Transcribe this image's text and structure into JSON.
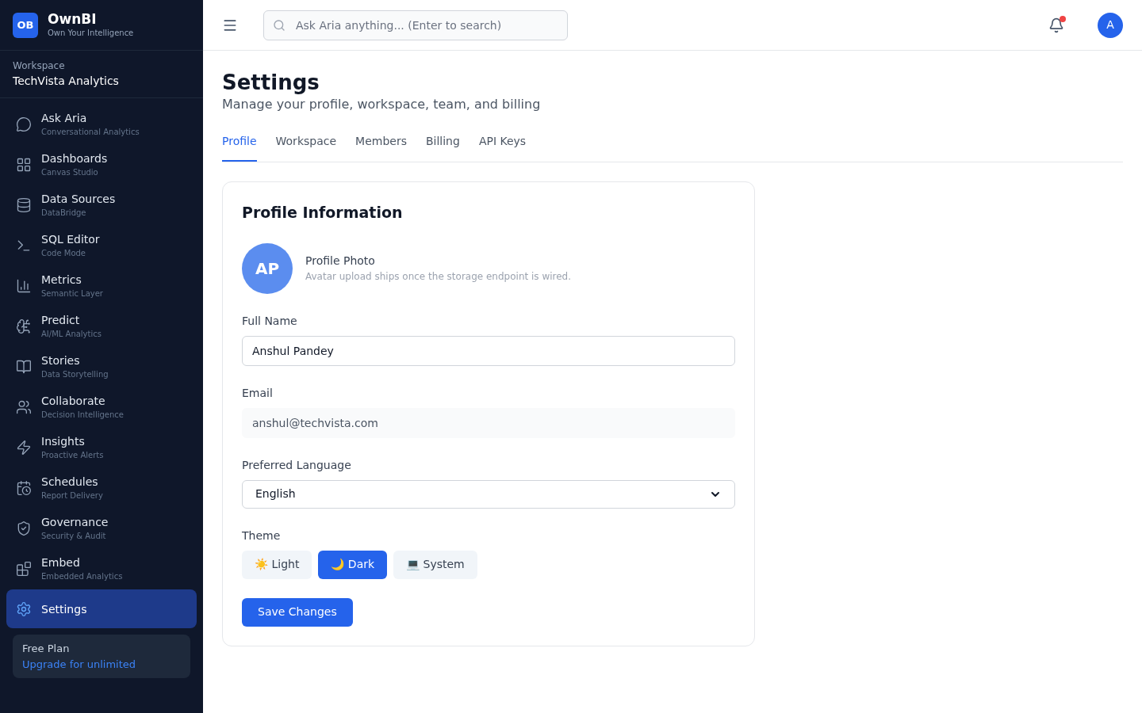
{
  "brand": {
    "logo": "OB",
    "name": "OwnBI",
    "tagline": "Own Your Intelligence"
  },
  "workspace": {
    "label": "Workspace",
    "name": "TechVista Analytics"
  },
  "nav": [
    {
      "label": "Ask Aria",
      "sub": "Conversational Analytics",
      "selected": false
    },
    {
      "label": "Dashboards",
      "sub": "Canvas Studio",
      "selected": false
    },
    {
      "label": "Data Sources",
      "sub": "DataBridge",
      "selected": false
    },
    {
      "label": "SQL Editor",
      "sub": "Code Mode",
      "selected": false
    },
    {
      "label": "Metrics",
      "sub": "Semantic Layer",
      "selected": false
    },
    {
      "label": "Predict",
      "sub": "AI/ML Analytics",
      "selected": false
    },
    {
      "label": "Stories",
      "sub": "Data Storytelling",
      "selected": false
    },
    {
      "label": "Collaborate",
      "sub": "Decision Intelligence",
      "selected": false
    },
    {
      "label": "Insights",
      "sub": "Proactive Alerts",
      "selected": false
    },
    {
      "label": "Schedules",
      "sub": "Report Delivery",
      "selected": false
    },
    {
      "label": "Governance",
      "sub": "Security & Audit",
      "selected": false
    },
    {
      "label": "Embed",
      "sub": "Embedded Analytics",
      "selected": false
    },
    {
      "label": "Settings",
      "selected": true
    }
  ],
  "plan": {
    "name": "Free Plan",
    "link": "Upgrade for unlimited"
  },
  "topbar": {
    "search_placeholder": "Ask Aria anything... (Enter to search)",
    "notification": true,
    "avatar": "A"
  },
  "page": {
    "title": "Settings",
    "subtitle": "Manage your profile, workspace, team, and billing"
  },
  "tabs": [
    {
      "label": "Profile",
      "selected": true
    },
    {
      "label": "Workspace",
      "selected": false
    },
    {
      "label": "Members",
      "selected": false
    },
    {
      "label": "Billing",
      "selected": false
    },
    {
      "label": "API Keys",
      "selected": false
    }
  ],
  "profile": {
    "title": "Profile Information",
    "avatar": "AP",
    "photo_label": "Profile Photo",
    "photo_hint": "Avatar upload ships once the storage endpoint is wired.",
    "fields": [
      {
        "kind": "text",
        "label": "Full Name",
        "value": "Anshul Pandey"
      },
      {
        "kind": "readonly",
        "label": "Email",
        "value": "anshul@techvista.com"
      },
      {
        "kind": "select",
        "label": "Preferred Language",
        "value": "English"
      }
    ],
    "theme_label": "Theme",
    "themes": [
      {
        "icon": "☀️",
        "label": "Light",
        "selected": false
      },
      {
        "icon": "🌙",
        "label": "Dark",
        "selected": true
      },
      {
        "icon": "💻",
        "label": "System",
        "selected": false
      }
    ],
    "save": "Save Changes"
  }
}
